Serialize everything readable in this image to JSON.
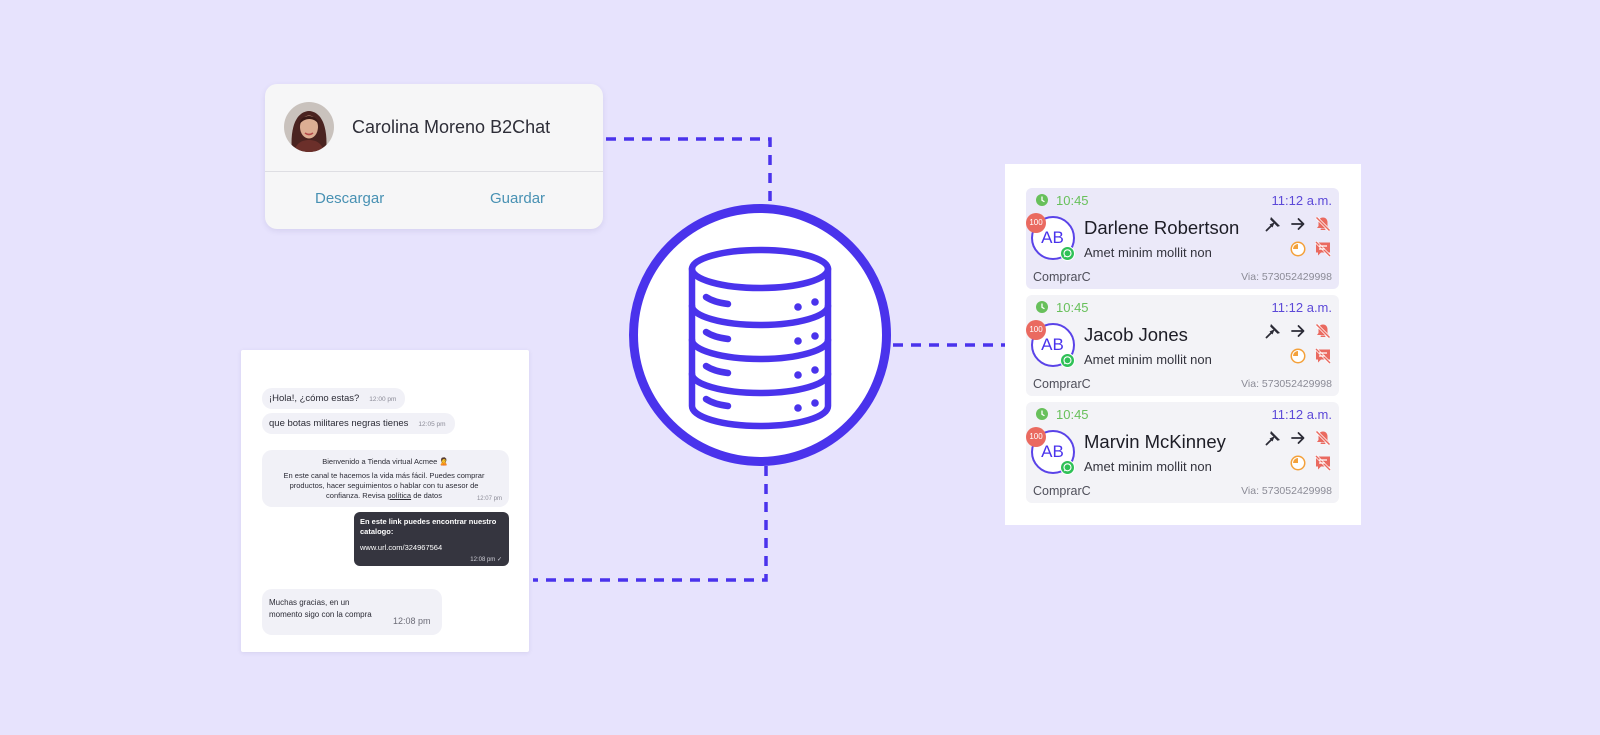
{
  "colors": {
    "background": "#e7e3fd",
    "accent": "#4a33ec",
    "connector": "#4a33ec",
    "green": "#68c05b",
    "badge": "#ea6a60",
    "link": "#4891b3"
  },
  "contact_card": {
    "name": "Carolina Moreno B2Chat",
    "download_label": "Descargar",
    "save_label": "Guardar"
  },
  "hub": {
    "icon": "database-icon"
  },
  "chat": {
    "msg1": {
      "text": "¡Hola!, ¿cómo estas?",
      "time": "12:00 pm"
    },
    "msg2": {
      "text": "que botas militares negras tienes",
      "time": "12:05 pm"
    },
    "msg3": {
      "title": "Bienvenido a Tienda virtual Acmee 🙎",
      "body": "En este canal te hacemos la vida más fácil. Puedes comprar productos, hacer seguimientos o hablar con tu asesor de confianza. Revisa",
      "link": "política",
      "body_end": "de datos",
      "time": "12:07 pm"
    },
    "msg4": {
      "text": "En este link puedes encontrar nuestro catalogo:",
      "url": "www.url.com/324967564",
      "time": "12:08 pm"
    },
    "msg5": {
      "text": "Muchas gracias, en un momento sigo con la compra",
      "time": "12:08 pm"
    }
  },
  "conversations": [
    {
      "wait_time": "10:45",
      "time": "11:12 a.m.",
      "initials": "AB",
      "unread": "100",
      "name": "Darlene Robertson",
      "preview": "Amet minim mollit non",
      "tag": "ComprarC",
      "via": "Via: 573052429998",
      "active": true
    },
    {
      "wait_time": "10:45",
      "time": "11:12 a.m.",
      "initials": "AB",
      "unread": "100",
      "name": "Jacob Jones",
      "preview": "Amet minim mollit non",
      "tag": "ComprarC",
      "via": "Via: 573052429998",
      "active": false
    },
    {
      "wait_time": "10:45",
      "time": "11:12 a.m.",
      "initials": "AB",
      "unread": "100",
      "name": "Marvin McKinney",
      "preview": "Amet minim mollit non",
      "tag": "ComprarC",
      "via": "Via: 573052429998",
      "active": false
    }
  ]
}
